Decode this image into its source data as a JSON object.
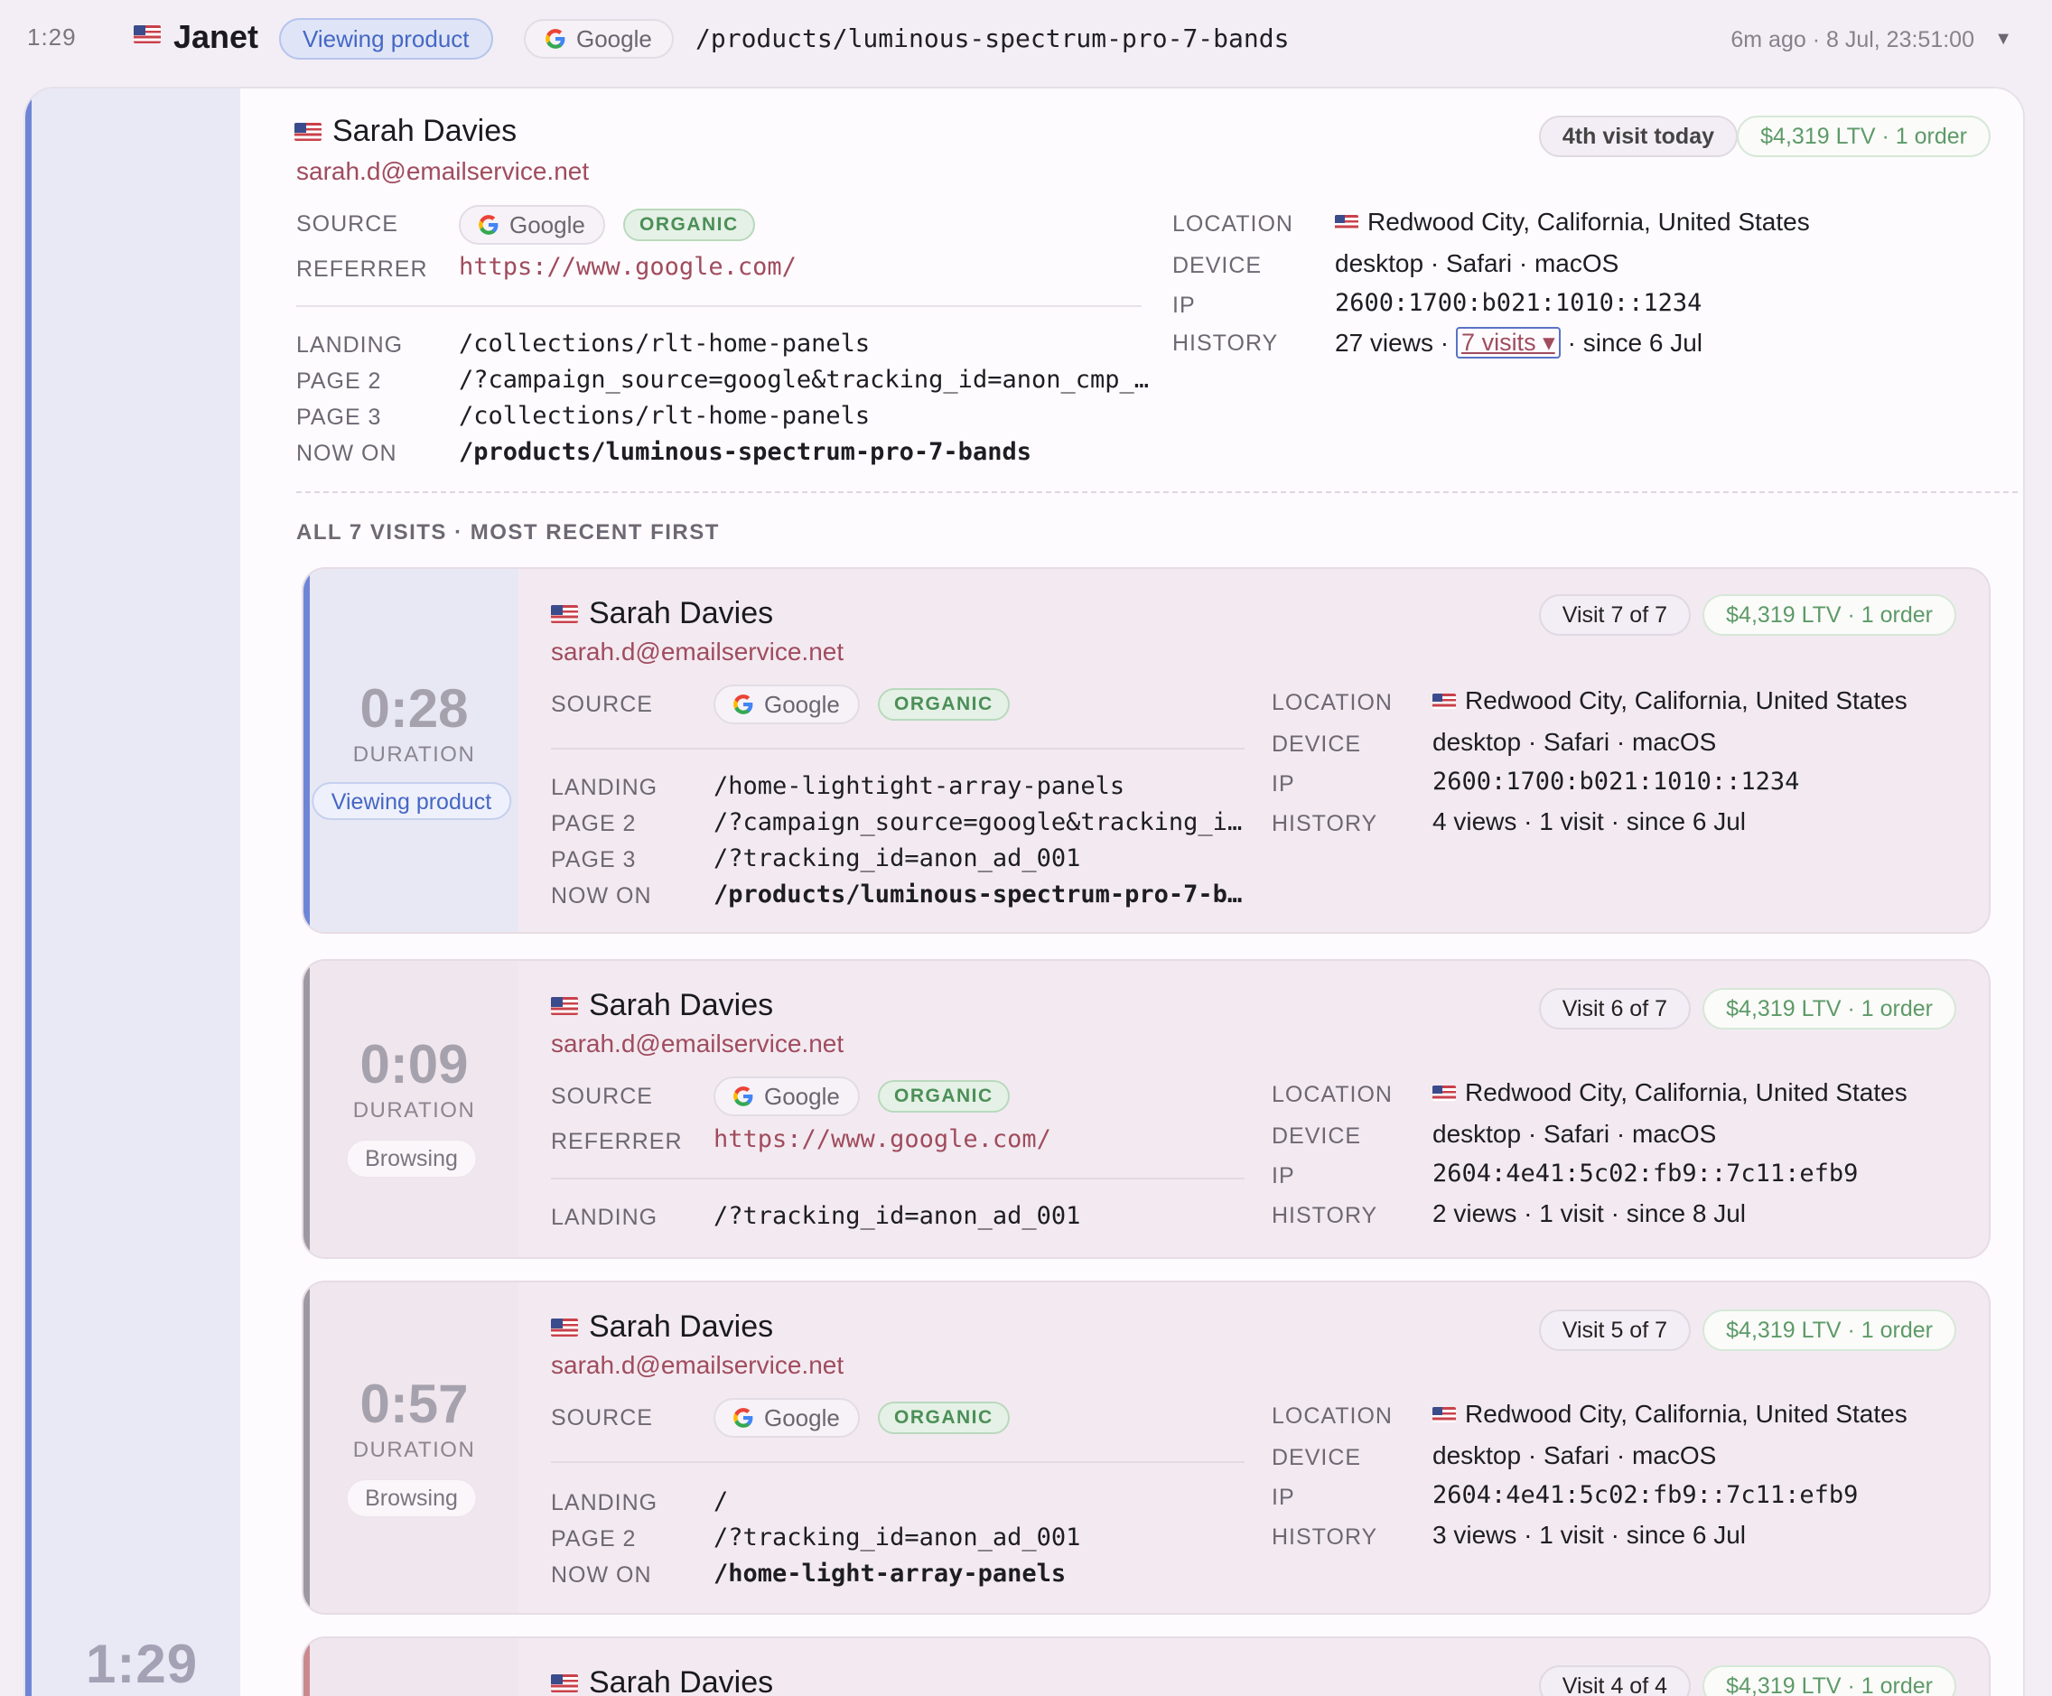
{
  "topbar": {
    "time": "1:29",
    "visitor_name": "Janet",
    "status": "Viewing product",
    "source": "Google",
    "path": "/products/luminous-spectrum-pro-7-bands",
    "ago": "6m ago · 8 Jul, 23:51:00"
  },
  "main": {
    "rail_time": "1:29",
    "name": "Sarah Davies",
    "email": "sarah.d@emailservice.net",
    "visit_today": "4th visit today",
    "ltv": "$4,319 LTV · 1 order",
    "source_label": "SOURCE",
    "source": "Google",
    "organic": "ORGANIC",
    "referrer_label": "REFERRER",
    "referrer": "https://www.google.com/",
    "pages": [
      {
        "label": "LANDING",
        "value": "/collections/rlt-home-panels"
      },
      {
        "label": "PAGE 2",
        "value": "/?campaign_source=google&tracking_id=anon_cmp_…"
      },
      {
        "label": "PAGE 3",
        "value": "/collections/rlt-home-panels"
      },
      {
        "label": "NOW ON",
        "value": "/products/luminous-spectrum-pro-7-bands"
      }
    ],
    "location_label": "LOCATION",
    "location": "Redwood City, California, United States",
    "device_label": "DEVICE",
    "device": "desktop · Safari · macOS",
    "ip_label": "IP",
    "ip": "2600:1700:b021:1010::1234",
    "history_label": "HISTORY",
    "history_views": "27 views ·",
    "history_visits_link": "7 visits ▾",
    "history_since": "· since 6 Jul",
    "visits_header": "ALL 7 VISITS · MOST RECENT FIRST"
  },
  "visits": [
    {
      "duration": "0:28",
      "duration_label": "DURATION",
      "state": "Viewing product",
      "name": "Sarah Davies",
      "email": "sarah.d@emailservice.net",
      "visit_num": "Visit 7 of 7",
      "ltv": "$4,319 LTV · 1 order",
      "source_label": "SOURCE",
      "source": "Google",
      "organic": "ORGANIC",
      "pages": [
        {
          "label": "LANDING",
          "value": "/home-lightight-array-panels"
        },
        {
          "label": "PAGE 2",
          "value": "/?campaign_source=google&tracking_i…"
        },
        {
          "label": "PAGE 3",
          "value": "/?tracking_id=anon_ad_001"
        },
        {
          "label": "NOW ON",
          "value": "/products/luminous-spectrum-pro-7-b…"
        }
      ],
      "location_label": "LOCATION",
      "location": "Redwood City, California, United States",
      "device_label": "DEVICE",
      "device": "desktop · Safari · macOS",
      "ip_label": "IP",
      "ip": "2600:1700:b021:1010::1234",
      "history_label": "HISTORY",
      "history": "4 views · 1 visit · since 6 Jul"
    },
    {
      "duration": "0:09",
      "duration_label": "DURATION",
      "state": "Browsing",
      "name": "Sarah Davies",
      "email": "sarah.d@emailservice.net",
      "visit_num": "Visit 6 of 7",
      "ltv": "$4,319 LTV · 1 order",
      "source_label": "SOURCE",
      "source": "Google",
      "organic": "ORGANIC",
      "referrer_label": "REFERRER",
      "referrer": "https://www.google.com/",
      "pages": [
        {
          "label": "LANDING",
          "value": "/?tracking_id=anon_ad_001"
        }
      ],
      "location_label": "LOCATION",
      "location": "Redwood City, California, United States",
      "device_label": "DEVICE",
      "device": "desktop · Safari · macOS",
      "ip_label": "IP",
      "ip": "2604:4e41:5c02:fb9::7c11:efb9",
      "history_label": "HISTORY",
      "history": "2 views · 1 visit · since 8 Jul"
    },
    {
      "duration": "0:57",
      "duration_label": "DURATION",
      "state": "Browsing",
      "name": "Sarah Davies",
      "email": "sarah.d@emailservice.net",
      "visit_num": "Visit 5 of 7",
      "ltv": "$4,319 LTV · 1 order",
      "source_label": "SOURCE",
      "source": "Google",
      "organic": "ORGANIC",
      "pages": [
        {
          "label": "LANDING",
          "value": "/"
        },
        {
          "label": "PAGE 2",
          "value": "/?tracking_id=anon_ad_001"
        },
        {
          "label": "NOW ON",
          "value": "/home-light-array-panels"
        }
      ],
      "location_label": "LOCATION",
      "location": "Redwood City, California, United States",
      "device_label": "DEVICE",
      "device": "desktop · Safari · macOS",
      "ip_label": "IP",
      "ip": "2604:4e41:5c02:fb9::7c11:efb9",
      "history_label": "HISTORY",
      "history": "3 views · 1 visit · since 6 Jul"
    },
    {
      "name": "Sarah Davies",
      "visit_num": "Visit 4 of 4",
      "ltv": "$4,319 LTV · 1 order"
    }
  ]
}
